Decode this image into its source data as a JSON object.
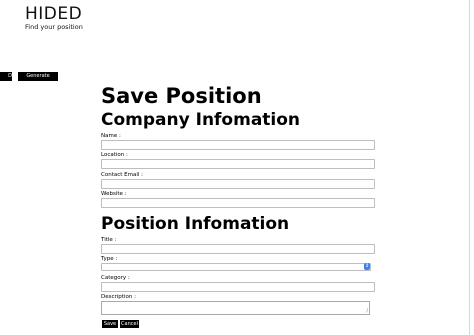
{
  "brand": {
    "name": "HIDED",
    "tagline": "Find your position"
  },
  "toolbar": {
    "d_label": "D",
    "generate_dummy_label": "Generate Dummy"
  },
  "page": {
    "title": "Save Position",
    "company_heading": "Company Infomation",
    "position_heading": "Position Infomation"
  },
  "company_fields": {
    "name": {
      "label": "Name :",
      "value": ""
    },
    "location": {
      "label": "Location :",
      "value": ""
    },
    "contact_email": {
      "label": "Contact Email :",
      "value": ""
    },
    "website": {
      "label": "Website :",
      "value": ""
    }
  },
  "position_fields": {
    "title": {
      "label": "Title :",
      "value": ""
    },
    "type": {
      "label": "Type :",
      "selected": ""
    },
    "category": {
      "label": "Category :",
      "value": ""
    },
    "description": {
      "label": "Description :",
      "value": ""
    }
  },
  "actions": {
    "save_label": "Save",
    "cancel_label": "Cancel"
  }
}
